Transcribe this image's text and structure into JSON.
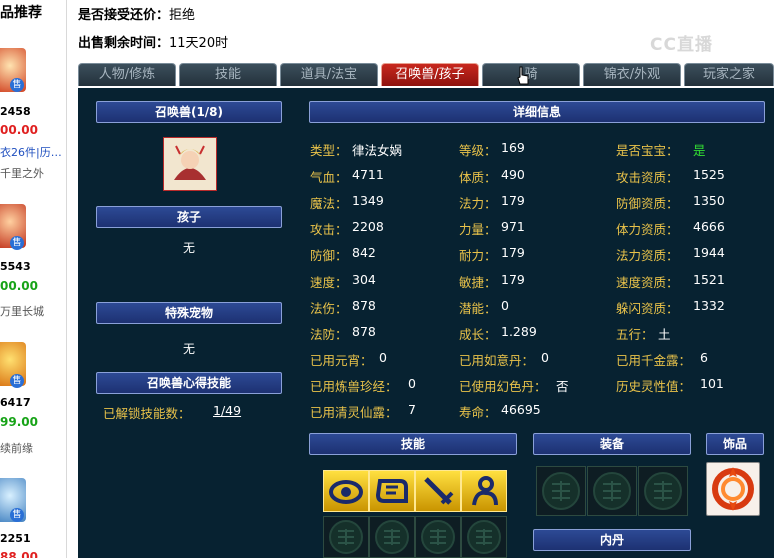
{
  "sidebar": {
    "title": "品推荐",
    "items": [
      {
        "id": "2458",
        "price": "00.00",
        "link": "衣26件|历…",
        "note": "千里之外",
        "sale": "售"
      },
      {
        "id": "5543",
        "price": "00.00",
        "note": "万里长城",
        "sale": "售"
      },
      {
        "id": "6417",
        "price": "99.00",
        "note": "续前缘",
        "sale": "售"
      },
      {
        "id": "2251",
        "price": "88.00",
        "sale": "售"
      }
    ]
  },
  "info": {
    "bargain_label": "是否接受还价：",
    "bargain_value": "拒绝",
    "time_label": "出售剩余时间：",
    "time_value": "11天20时"
  },
  "watermark": "CC直播",
  "tabs": [
    "人物/修炼",
    "技能",
    "道具/法宝",
    "召唤兽/孩子",
    "骑",
    "锦衣/外观",
    "玩家之家"
  ],
  "left": {
    "summon_header": "召唤兽(1/8)",
    "child_header": "孩子",
    "child_value": "无",
    "pet_header": "特殊宠物",
    "pet_value": "无",
    "skill_header": "召唤兽心得技能",
    "unlock_label": "已解锁技能数：",
    "unlock_value": "1/49"
  },
  "detail": {
    "header": "详细信息",
    "col1": [
      {
        "label": "类型：",
        "value": "律法女娲"
      },
      {
        "label": "气血：",
        "value": "4711"
      },
      {
        "label": "魔法：",
        "value": "1349"
      },
      {
        "label": "攻击：",
        "value": "2208"
      },
      {
        "label": "防御：",
        "value": "842"
      },
      {
        "label": "速度：",
        "value": "304"
      },
      {
        "label": "法伤：",
        "value": "878"
      },
      {
        "label": "法防：",
        "value": "878"
      },
      {
        "label": "已用元宵：",
        "value": "0"
      },
      {
        "label": "已用炼兽珍经：",
        "value": "0"
      },
      {
        "label": "已用清灵仙露：",
        "value": "7"
      }
    ],
    "col2": [
      {
        "label": "等级：",
        "value": "169"
      },
      {
        "label": "体质：",
        "value": "490"
      },
      {
        "label": "法力：",
        "value": "179"
      },
      {
        "label": "力量：",
        "value": "971"
      },
      {
        "label": "耐力：",
        "value": "179"
      },
      {
        "label": "敏捷：",
        "value": "179"
      },
      {
        "label": "潜能：",
        "value": "0"
      },
      {
        "label": "成长：",
        "value": "1.289"
      },
      {
        "label": "已用如意丹：",
        "value": "0"
      },
      {
        "label": "已使用幻色丹：",
        "value": "否"
      },
      {
        "label": "寿命：",
        "value": "46695"
      }
    ],
    "col3": [
      {
        "label": "是否宝宝：",
        "value": "是"
      },
      {
        "label": "攻击资质：",
        "value": "1525"
      },
      {
        "label": "防御资质：",
        "value": "1350"
      },
      {
        "label": "体力资质：",
        "value": "4666"
      },
      {
        "label": "法力资质：",
        "value": "1944"
      },
      {
        "label": "速度资质：",
        "value": "1521"
      },
      {
        "label": "躲闪资质：",
        "value": "1332"
      },
      {
        "label": "五行：",
        "value": "土"
      },
      {
        "label": "已用千金露：",
        "value": "6"
      },
      {
        "label": "历史灵性值：",
        "value": "101"
      }
    ]
  },
  "sections": {
    "skills": "技能",
    "equip": "装备",
    "ornament": "饰品",
    "neidan": "内丹"
  },
  "colors": {
    "label": "#e8c24a",
    "panel": "#072231",
    "active_tab": "#b01e16"
  }
}
